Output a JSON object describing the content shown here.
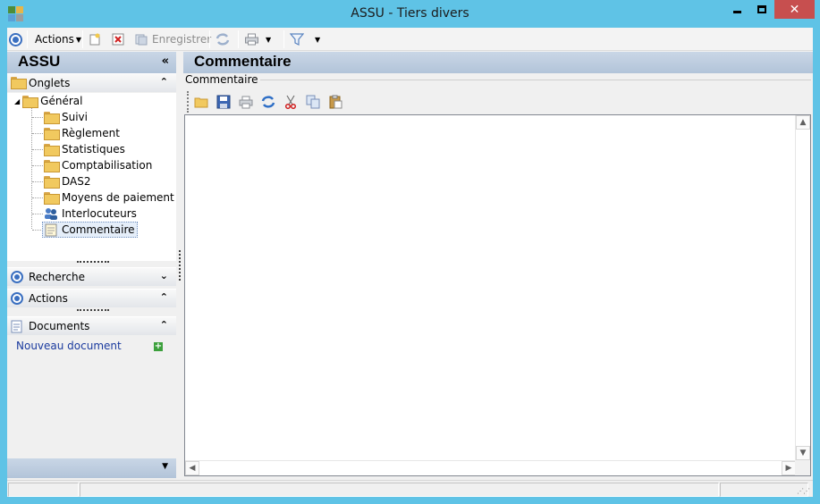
{
  "window": {
    "title": "ASSU -  Tiers divers",
    "close_glyph": "✕"
  },
  "toolbar": {
    "actions_label": "Actions",
    "save_label": "Enregistrer"
  },
  "left_panel": {
    "title": "ASSU",
    "collapse_glyph": "«",
    "onglets_label": "Onglets",
    "tree": {
      "root": "Général",
      "children": [
        "Suivi",
        "Règlement",
        "Statistiques",
        "Comptabilisation",
        "DAS2",
        "Moyens de paiement",
        "Interlocuteurs",
        "Commentaire"
      ],
      "selected": "Commentaire"
    },
    "recherche_label": "Recherche",
    "actions_label": "Actions",
    "documents_label": "Documents",
    "new_document_link": "Nouveau document",
    "plus_glyph": "+",
    "chev_up": "⌃",
    "chev_down": "⌄",
    "footer_chev": "▼"
  },
  "right_panel": {
    "title": "Commentaire",
    "group_label": "Commentaire",
    "editor_text": ""
  },
  "colors": {
    "titlebar": "#5fc3e6",
    "close_button": "#c74f4f",
    "header_gradient": "#b2c4d9",
    "link": "#1a3a9e"
  }
}
